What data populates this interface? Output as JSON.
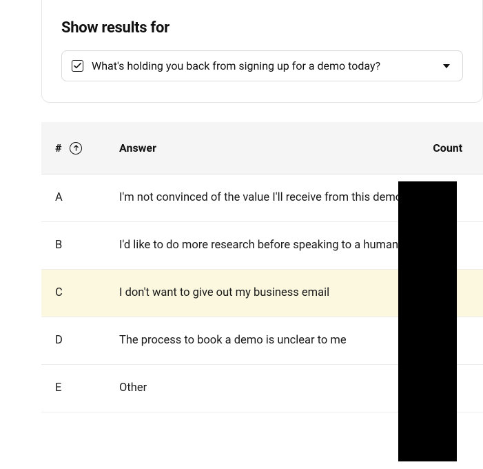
{
  "filter": {
    "title": "Show results for",
    "question": "What's holding you back from signing up for a demo today?"
  },
  "columns": {
    "hash": "#",
    "answer": "Answer",
    "count": "Count"
  },
  "rows": [
    {
      "letter": "A",
      "answer": "I'm not convinced of the value I'll receive from this demo",
      "highlight": false
    },
    {
      "letter": "B",
      "answer": "I'd like to do more research before speaking to a human",
      "highlight": false
    },
    {
      "letter": "C",
      "answer": "I don't want to give out my business email",
      "highlight": true
    },
    {
      "letter": "D",
      "answer": "The process to book a demo is unclear to me",
      "highlight": false
    },
    {
      "letter": "E",
      "answer": "Other",
      "highlight": false
    }
  ]
}
